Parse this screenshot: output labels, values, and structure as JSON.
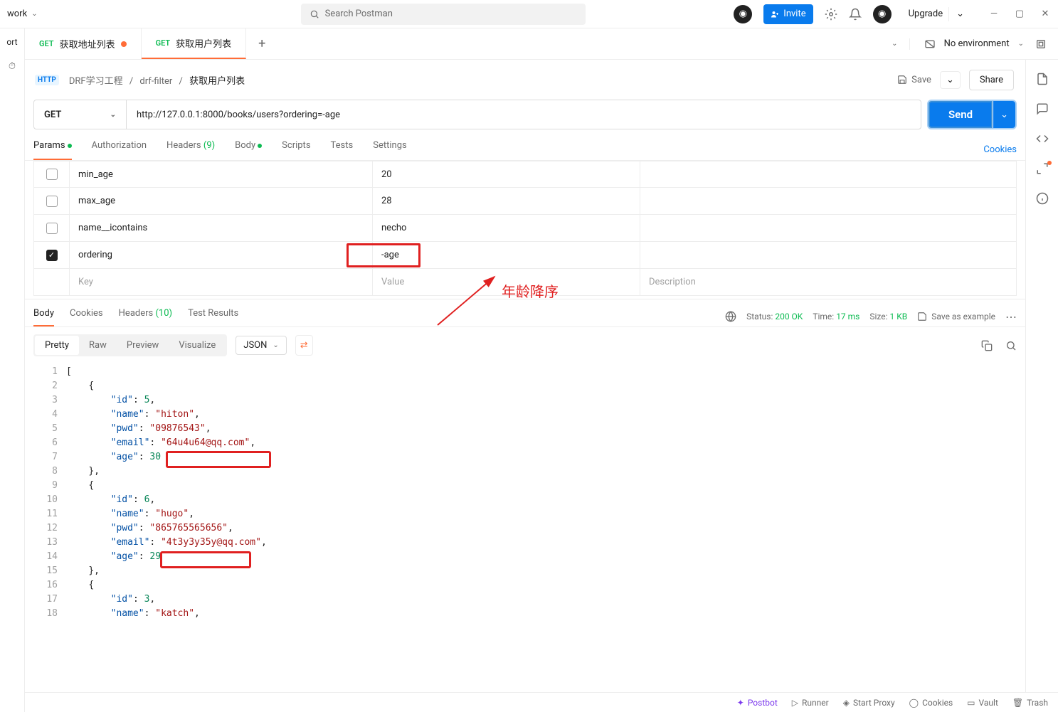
{
  "topbar": {
    "leftLabel": "work",
    "searchPlaceholder": "Search Postman",
    "inviteLabel": "Invite",
    "upgradeLabel": "Upgrade"
  },
  "leftGutter": {
    "importLabel": "ort"
  },
  "tabs": [
    {
      "method": "GET",
      "title": "获取地址列表",
      "active": false,
      "dirty": true
    },
    {
      "method": "GET",
      "title": "获取用户列表",
      "active": true,
      "dirty": false
    }
  ],
  "environment": {
    "label": "No environment"
  },
  "breadcrumb": {
    "workspace": "DRF学习工程",
    "folder": "drf-filter",
    "request": "获取用户列表"
  },
  "actions": {
    "save": "Save",
    "share": "Share"
  },
  "request": {
    "method": "GET",
    "url": "http://127.0.0.1:8000/books/users?ordering=-age",
    "sendLabel": "Send"
  },
  "reqTabs": {
    "params": "Params",
    "authorization": "Authorization",
    "headers": "Headers",
    "headersCount": "(9)",
    "body": "Body",
    "scripts": "Scripts",
    "tests": "Tests",
    "settings": "Settings",
    "cookies": "Cookies"
  },
  "params": [
    {
      "checked": false,
      "key": "min_age",
      "value": "20",
      "desc": ""
    },
    {
      "checked": false,
      "key": "max_age",
      "value": "28",
      "desc": ""
    },
    {
      "checked": false,
      "key": "name__icontains",
      "value": "necho",
      "desc": ""
    },
    {
      "checked": true,
      "key": "ordering",
      "value": "-age",
      "desc": ""
    }
  ],
  "paramsPlaceholder": {
    "key": "Key",
    "value": "Value",
    "desc": "Description"
  },
  "annotation": {
    "text": "年龄降序"
  },
  "respTabs": {
    "body": "Body",
    "cookies": "Cookies",
    "headers": "Headers",
    "headersCount": "(10)",
    "testResults": "Test Results"
  },
  "respMeta": {
    "statusLabel": "Status:",
    "statusValue": "200 OK",
    "timeLabel": "Time:",
    "timeValue": "17 ms",
    "sizeLabel": "Size:",
    "sizeValue": "1 KB",
    "saveExample": "Save as example"
  },
  "respToolbar": {
    "pretty": "Pretty",
    "raw": "Raw",
    "preview": "Preview",
    "visualize": "Visualize",
    "format": "JSON"
  },
  "responseBody": [
    {
      "id": 5,
      "name": "hiton",
      "pwd": "09876543",
      "email": "64u4u64@qq.com",
      "age": 30
    },
    {
      "id": 6,
      "name": "hugo",
      "pwd": "865765565656",
      "email": "4t3y3y35y@qq.com",
      "age": 29
    },
    {
      "id": 3,
      "name": "katch"
    }
  ],
  "bottomBar": {
    "postbot": "Postbot",
    "runner": "Runner",
    "startProxy": "Start Proxy",
    "cookies": "Cookies",
    "vault": "Vault",
    "trash": "Trash"
  }
}
